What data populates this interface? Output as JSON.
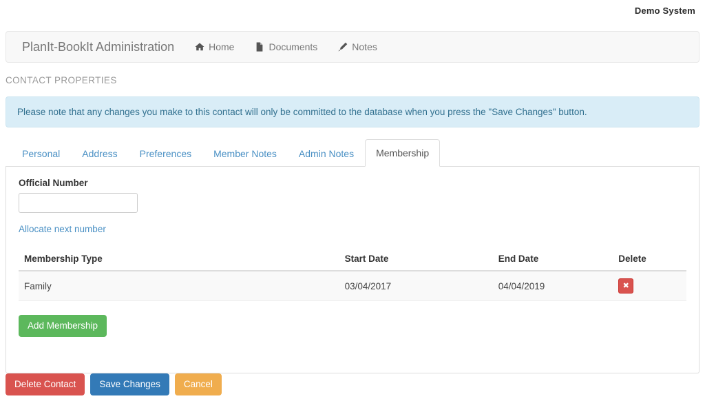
{
  "topbar": {
    "system_label": "Demo System"
  },
  "navbar": {
    "brand": "PlanIt-BookIt Administration",
    "links": [
      {
        "label": "Home",
        "icon": "home-icon"
      },
      {
        "label": "Documents",
        "icon": "document-icon"
      },
      {
        "label": "Notes",
        "icon": "pencil-icon"
      }
    ]
  },
  "page": {
    "section_title": "CONTACT PROPERTIES",
    "alert_text": "Please note that any changes you make to this contact will only be committed to the database when you press the \"Save Changes\" button."
  },
  "tabs": [
    {
      "label": "Personal",
      "active": false
    },
    {
      "label": "Address",
      "active": false
    },
    {
      "label": "Preferences",
      "active": false
    },
    {
      "label": "Member Notes",
      "active": false
    },
    {
      "label": "Admin Notes",
      "active": false
    },
    {
      "label": "Membership",
      "active": true
    }
  ],
  "membership": {
    "official_number_label": "Official Number",
    "official_number_value": "",
    "official_number_placeholder": "",
    "allocate_link": "Allocate next number",
    "table": {
      "headers": [
        "Membership Type",
        "Start Date",
        "End Date",
        "Delete"
      ],
      "rows": [
        {
          "type": "Family",
          "start_date": "03/04/2017",
          "end_date": "04/04/2019",
          "delete_glyph": "✖"
        }
      ]
    },
    "add_button": "Add Membership"
  },
  "footer": {
    "delete_contact": "Delete Contact",
    "save_changes": "Save Changes",
    "cancel": "Cancel"
  },
  "colors": {
    "brand_text": "#777777",
    "link": "#4a90c4",
    "alert_bg": "#d9edf7",
    "alert_text": "#31708f",
    "success": "#5cb85c",
    "danger": "#d9534f",
    "primary": "#337ab7",
    "warning": "#f0ad4e"
  }
}
